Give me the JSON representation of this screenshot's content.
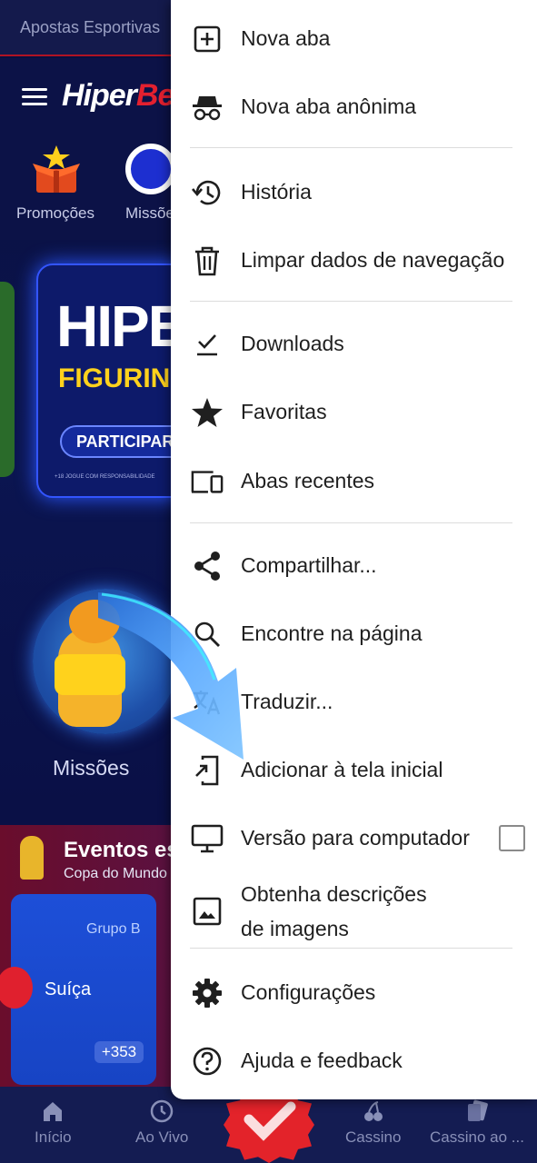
{
  "background": {
    "topbar_text": "Apostas Esportivas",
    "logo_white": "Hiper",
    "logo_red": "Be",
    "quick_links": [
      {
        "label": "Promoções",
        "icon": "gift-box-icon"
      },
      {
        "label": "Missõe",
        "icon": "target-icon"
      }
    ],
    "banner": {
      "title": "HIPE",
      "subtitle": "FIGURINH",
      "button": "PARTICIPAR A",
      "disclaimer": "+18  JOGUE COM RESPONSABILIDADE"
    },
    "missions_label": "Missões",
    "events": {
      "title": "Eventos es",
      "subtitle": "Copa do Mundo",
      "group": "Grupo B",
      "team": "Suíça",
      "odds": "+353"
    },
    "bottom_nav": [
      {
        "label": "Início",
        "icon": "home-icon"
      },
      {
        "label": "Ao Vivo",
        "icon": "clock-icon"
      },
      {
        "label": "Cassino",
        "icon": "cherries-icon"
      },
      {
        "label": "Cassino ao ...",
        "icon": "cards-icon"
      }
    ]
  },
  "menu": {
    "items": [
      {
        "label": "Nova aba",
        "icon": "new-tab-icon"
      },
      {
        "label": "Nova aba anônima",
        "icon": "incognito-icon"
      },
      {
        "label": "História",
        "icon": "history-icon"
      },
      {
        "label": "Limpar dados de navegação",
        "icon": "trash-icon"
      },
      {
        "label": "Downloads",
        "icon": "download-check-icon"
      },
      {
        "label": "Favoritas",
        "icon": "star-icon"
      },
      {
        "label": "Abas recentes",
        "icon": "devices-icon"
      },
      {
        "label": "Compartilhar...",
        "icon": "share-icon"
      },
      {
        "label": "Encontre na página",
        "icon": "find-icon"
      },
      {
        "label": "Traduzir...",
        "icon": "translate-icon"
      },
      {
        "label": "Adicionar à tela inicial",
        "icon": "add-to-home-icon"
      },
      {
        "label": "Versão para computador",
        "icon": "desktop-icon"
      },
      {
        "label_line1": "Obtenha descrições",
        "label_line2": "de imagens",
        "icon": "image-icon"
      },
      {
        "label": "Configurações",
        "icon": "gear-icon"
      },
      {
        "label": "Ajuda e feedback",
        "icon": "help-icon"
      }
    ],
    "desktop_checkbox_checked": false
  }
}
